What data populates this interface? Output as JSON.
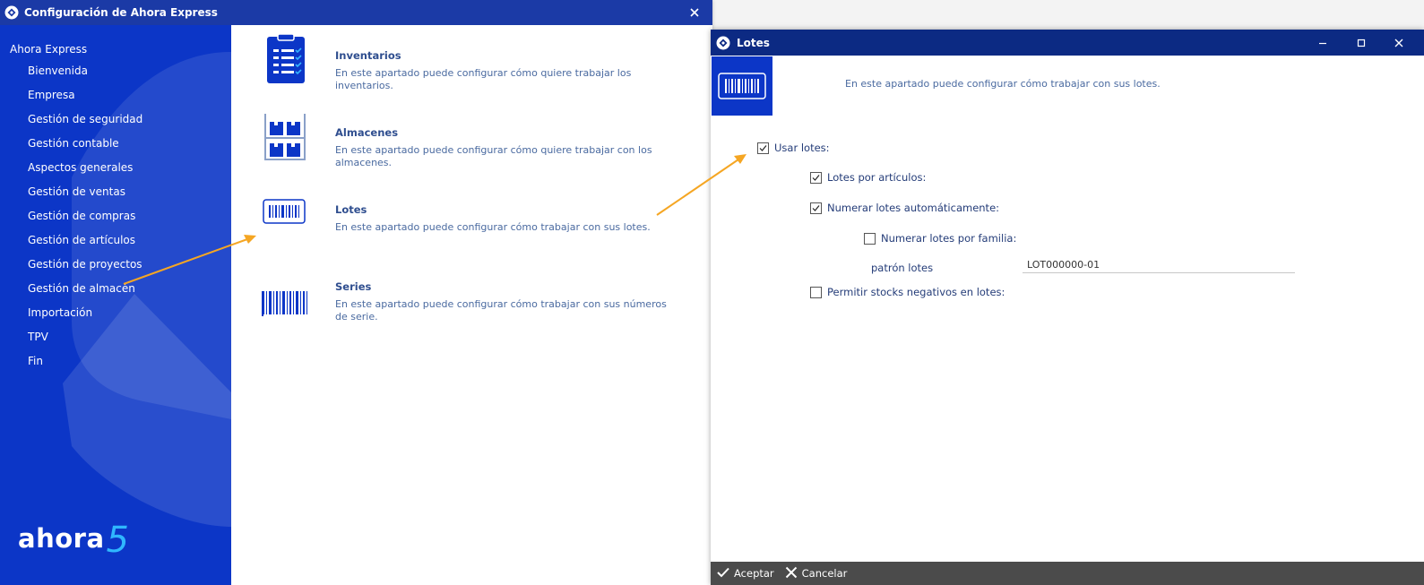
{
  "main_window": {
    "title": "Configuración de Ahora Express"
  },
  "sidebar": {
    "root": "Ahora Express",
    "items": [
      {
        "label": "Bienvenida"
      },
      {
        "label": "Empresa"
      },
      {
        "label": "Gestión de seguridad"
      },
      {
        "label": "Gestión contable"
      },
      {
        "label": "Aspectos generales"
      },
      {
        "label": "Gestión de ventas"
      },
      {
        "label": "Gestión de compras"
      },
      {
        "label": "Gestión de artículos"
      },
      {
        "label": "Gestión de proyectos"
      },
      {
        "label": "Gestión de almacén"
      },
      {
        "label": "Importación"
      },
      {
        "label": "TPV"
      },
      {
        "label": "Fin"
      }
    ],
    "brand": "ahora",
    "brand_version": "5"
  },
  "options": [
    {
      "title": "Inventarios",
      "description": "En este apartado puede configurar cómo quiere trabajar los inventarios.",
      "icon": "clipboard-checklist-icon"
    },
    {
      "title": "Almacenes",
      "description": "En este apartado puede configurar cómo quiere trabajar con los almacenes.",
      "icon": "warehouse-shelves-icon"
    },
    {
      "title": "Lotes",
      "description": "En este apartado puede configurar cómo trabajar con sus lotes.",
      "icon": "barcode-label-icon"
    },
    {
      "title": "Series",
      "description": "En este apartado puede configurar cómo trabajar con sus números de serie.",
      "icon": "barcode-icon"
    }
  ],
  "dialog": {
    "title": "Lotes",
    "description": "En este apartado puede configurar cómo trabajar con sus lotes.",
    "checkboxes": {
      "usar_lotes": {
        "label": "Usar lotes:",
        "checked": true
      },
      "lotes_por_articulos": {
        "label": "Lotes por artículos:",
        "checked": true
      },
      "numerar_auto": {
        "label": "Numerar lotes automáticamente:",
        "checked": true
      },
      "numerar_familia": {
        "label": "Numerar lotes por familia:",
        "checked": false
      },
      "stocks_negativos": {
        "label": "Permitir stocks negativos en lotes:",
        "checked": false
      }
    },
    "pattern_label": "patrón lotes",
    "pattern_value": "LOT000000-01",
    "footer": {
      "accept": "Aceptar",
      "cancel": "Cancelar"
    }
  },
  "colors": {
    "sidebar_blue": "#0c36c7",
    "titlebar_blue": "#1b3aa6",
    "dialog_titlebar": "#0c2a83",
    "annotation_arrow": "#f5a623",
    "footer_gray": "#4b4b4b"
  }
}
